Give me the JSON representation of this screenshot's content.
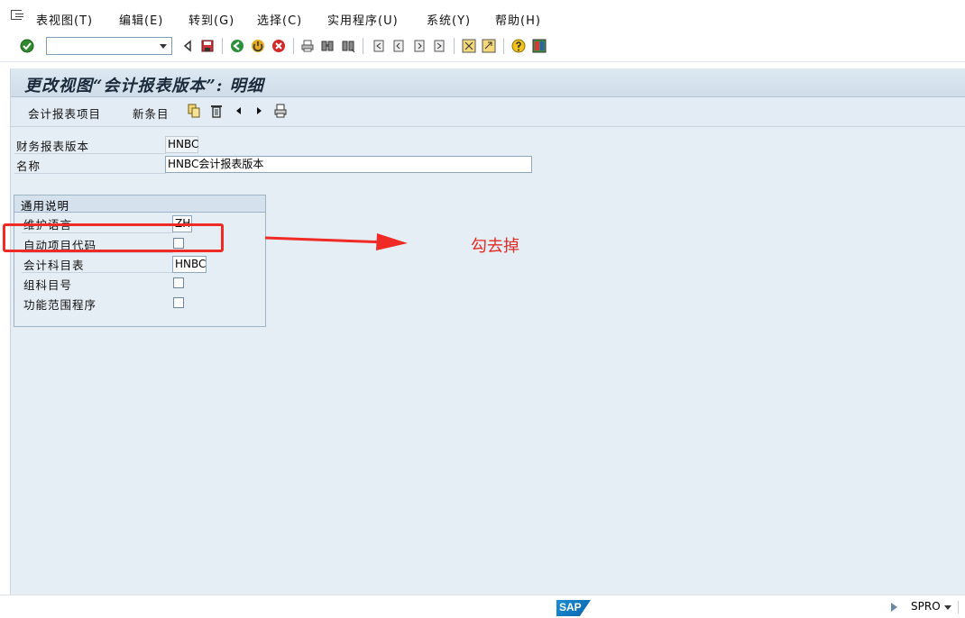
{
  "menu": {
    "items": [
      "表视图(T)",
      "编辑(E)",
      "转到(G)",
      "选择(C)",
      "实用程序(U)",
      "系统(Y)",
      "帮助(H)"
    ]
  },
  "toolbar": {
    "command_field_value": "",
    "icons": [
      "enter-icon",
      "back-triangle-icon",
      "save-icon",
      "back-icon",
      "exit-icon",
      "cancel-icon",
      "print-icon",
      "find-icon",
      "find-next-icon",
      "first-page-icon",
      "prev-page-icon",
      "next-page-icon",
      "last-page-icon",
      "create-session-icon",
      "shortcut-icon",
      "help-icon",
      "customize-layout-icon"
    ]
  },
  "screen": {
    "title": "更改视图“会计报表版本”: 明细",
    "app_toolbar": {
      "btn_items": "会计报表项目",
      "btn_new": "新条目",
      "icons": [
        "copy-icon",
        "delete-icon",
        "previous-icon",
        "next-icon",
        "print-icon"
      ]
    },
    "fields": {
      "version_label": "财务报表版本",
      "version_value": "HNBC",
      "name_label": "名称",
      "name_value": "HNBC会计报表版本"
    },
    "group": {
      "title": "通用说明",
      "lang_label": "维护语言",
      "lang_value": "ZH",
      "auto_code_label": "自动项目代码",
      "auto_code_checked": false,
      "coa_label": "会计科目表",
      "coa_value": "HNBC",
      "group_acct_label": "组科目号",
      "group_acct_checked": false,
      "func_area_label": "功能范围程序",
      "func_area_checked": false
    }
  },
  "annotation": {
    "text": "勾去掉",
    "color": "#e32b26"
  },
  "status": {
    "logo_text": "SAP",
    "transaction": "SPRO"
  },
  "colors": {
    "background": "#e6eef5",
    "title_bar": "#cfdde9",
    "accent": "#1b7fc9"
  }
}
